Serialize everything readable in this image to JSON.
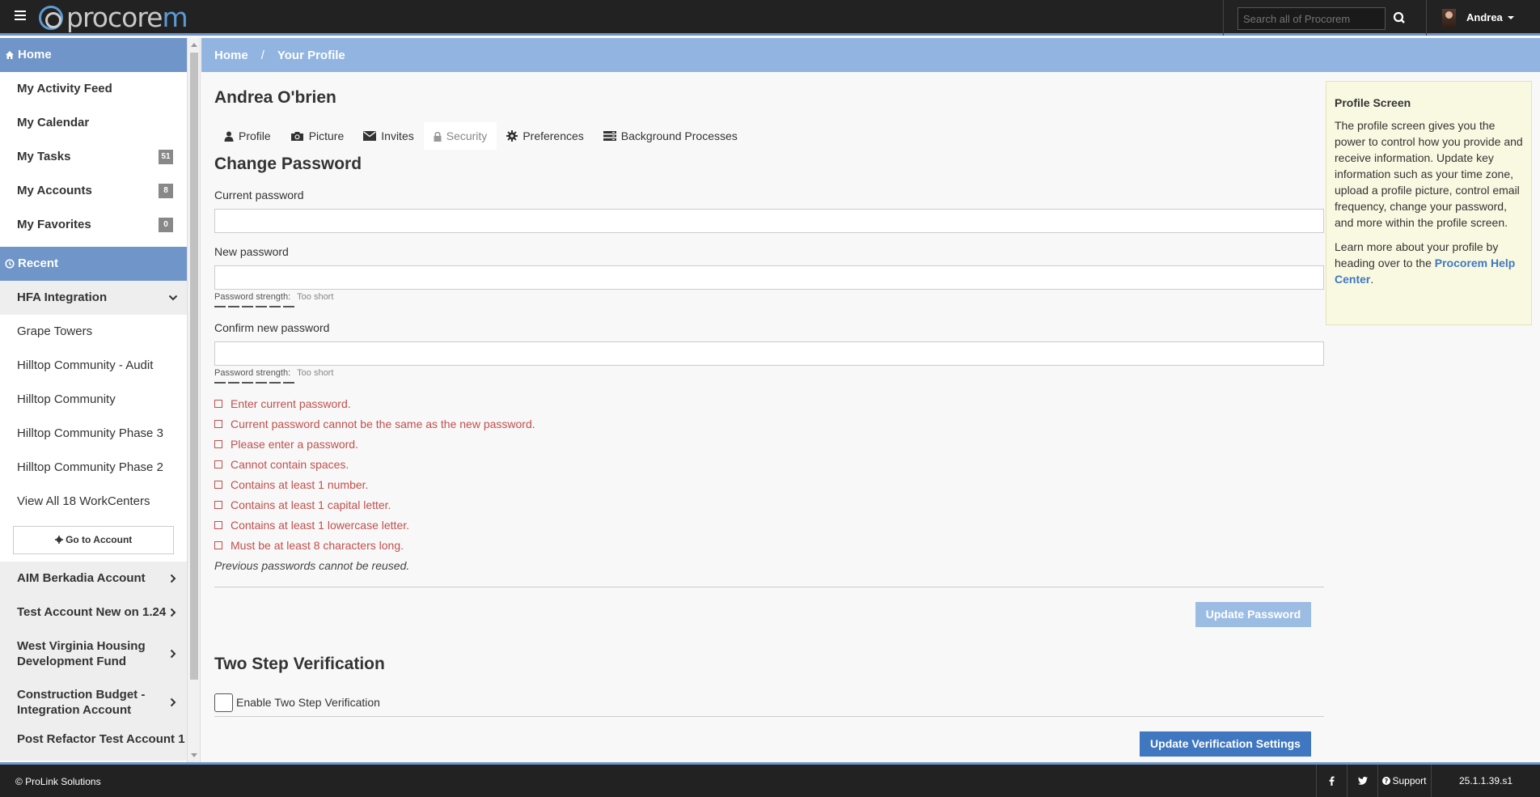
{
  "topbar": {
    "logo_pro": "procore",
    "logo_m": "m",
    "search_placeholder": "Search all of Procorem",
    "user_name": "Andrea"
  },
  "sidebar": {
    "home_label": "Home",
    "items": [
      {
        "label": "My Activity Feed"
      },
      {
        "label": "My Calendar"
      },
      {
        "label": "My Tasks",
        "badge": "51"
      },
      {
        "label": "My Accounts",
        "badge": "8"
      },
      {
        "label": "My Favorites",
        "badge": "0"
      }
    ],
    "recent_label": "Recent",
    "recent_group": "HFA Integration",
    "recent_items": [
      "Grape Towers",
      "Hilltop Community - Audit",
      "Hilltop Community",
      "Hilltop Community Phase 3",
      "Hilltop Community Phase 2",
      "View All 18 WorkCenters"
    ],
    "go_to_account": "Go to Account",
    "accounts": [
      "AIM Berkadia Account",
      "Test Account New on 1.24",
      "West Virginia Housing Development Fund",
      "Construction Budget - Integration Account",
      "Post Refactor Test Account 1"
    ]
  },
  "breadcrumb": {
    "home": "Home",
    "sep": "/",
    "current": "Your Profile"
  },
  "profile": {
    "name": "Andrea O'brien",
    "tabs": [
      "Profile",
      "Picture",
      "Invites",
      "Security",
      "Preferences",
      "Background Processes"
    ],
    "active_tab": "Security"
  },
  "change_password": {
    "title": "Change Password",
    "current_label": "Current password",
    "new_label": "New password",
    "confirm_label": "Confirm new password",
    "strength_label": "Password strength:",
    "strength_value": "Too short",
    "rules": [
      "Enter current password.",
      "Current password cannot be the same as the new password.",
      "Please enter a password.",
      "Cannot contain spaces.",
      "Contains at least 1 number.",
      "Contains at least 1 capital letter.",
      "Contains at least 1 lowercase letter.",
      "Must be at least 8 characters long."
    ],
    "note": "Previous passwords cannot be reused.",
    "button": "Update Password"
  },
  "two_step": {
    "title": "Two Step Verification",
    "checkbox_label": "Enable Two Step Verification",
    "checked": false,
    "button": "Update Verification Settings"
  },
  "help": {
    "title": "Profile Screen",
    "p1": "The profile screen gives you the power to control how you provide and receive information. Update key information such as your time zone, upload a profile picture, control email frequency, change your password, and more within the profile screen.",
    "p2_prefix": "Learn more about your profile by heading over to the ",
    "p2_link": "Procorem Help Center",
    "p2_suffix": "."
  },
  "footer": {
    "copyright": "© ProLink Solutions",
    "support": "Support",
    "version": "25.1.1.39.s1"
  },
  "colors": {
    "accent": "#6f95c9",
    "breadcrumb_bg": "#91b4e0",
    "error": "#c0504d",
    "primary_button": "#3f78c0",
    "help_bg": "#f9f9e2"
  }
}
